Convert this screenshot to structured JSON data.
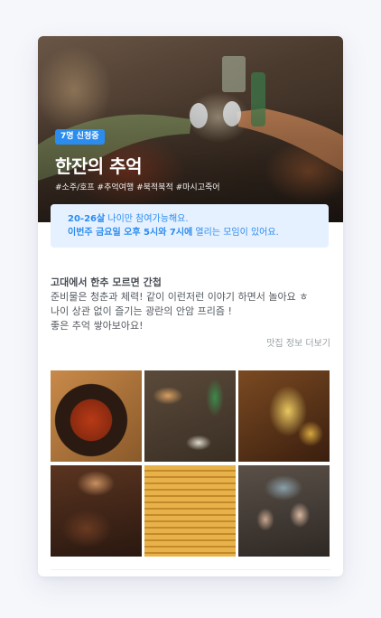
{
  "hero": {
    "badge": "7명 신청중",
    "title": "한잔의 추억",
    "tags": "#소주/호프 #추억여행 #북적북적 #마시고죽어"
  },
  "notice": {
    "line1_highlight": "20-26살",
    "line1_rest": " 나이만 참여가능해요.",
    "line2_highlight": "이번주 금요일 오후 5시와 7시에",
    "line2_rest": " 열리는 모임이 있어요."
  },
  "description": {
    "title": "고대에서 한추 모르면 간첩",
    "lines": [
      "준비물은 청춘과 체력! 같이 이런저런 이야기 하면서 놀아요 ㅎ",
      "나이 상관 없이 즐기는 광란의 안암 프리즘 !",
      "좋은 추억 쌓아보아요!"
    ]
  },
  "more_link": "맛집 정보 더보기",
  "photos": [
    {
      "label": "photo-1"
    },
    {
      "label": "photo-2"
    },
    {
      "label": "photo-3"
    },
    {
      "label": "photo-4"
    },
    {
      "label": "photo-5"
    },
    {
      "label": "photo-6"
    }
  ],
  "colors": {
    "accent": "#2b8cf0",
    "notice_bg": "#e6f1ff"
  }
}
